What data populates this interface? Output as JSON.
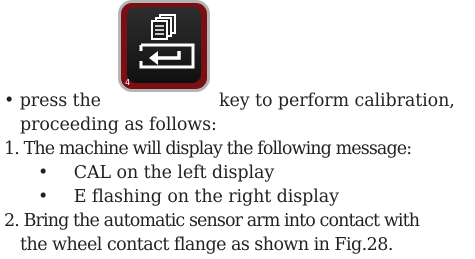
{
  "key": {
    "icon": "document-copy-enter-key-icon",
    "number": "4",
    "colors": {
      "frame": "#7a0f14",
      "face": "#1a1a1a",
      "glyph": "#ffffff"
    }
  },
  "bullet_char": "•",
  "intro": {
    "before_key": "press the",
    "after_key": "key to perform calibration,",
    "continuation": "proceeding as follows:"
  },
  "steps": [
    {
      "number": "1.",
      "text": "The machine will display the following message:",
      "sub_items": [
        "CAL on the left display",
        "E flashing on the right display"
      ]
    },
    {
      "number": "2.",
      "text": "Bring the automatic sensor arm into contact with",
      "continuation": "the wheel contact flange as shown in Fig.28."
    }
  ]
}
